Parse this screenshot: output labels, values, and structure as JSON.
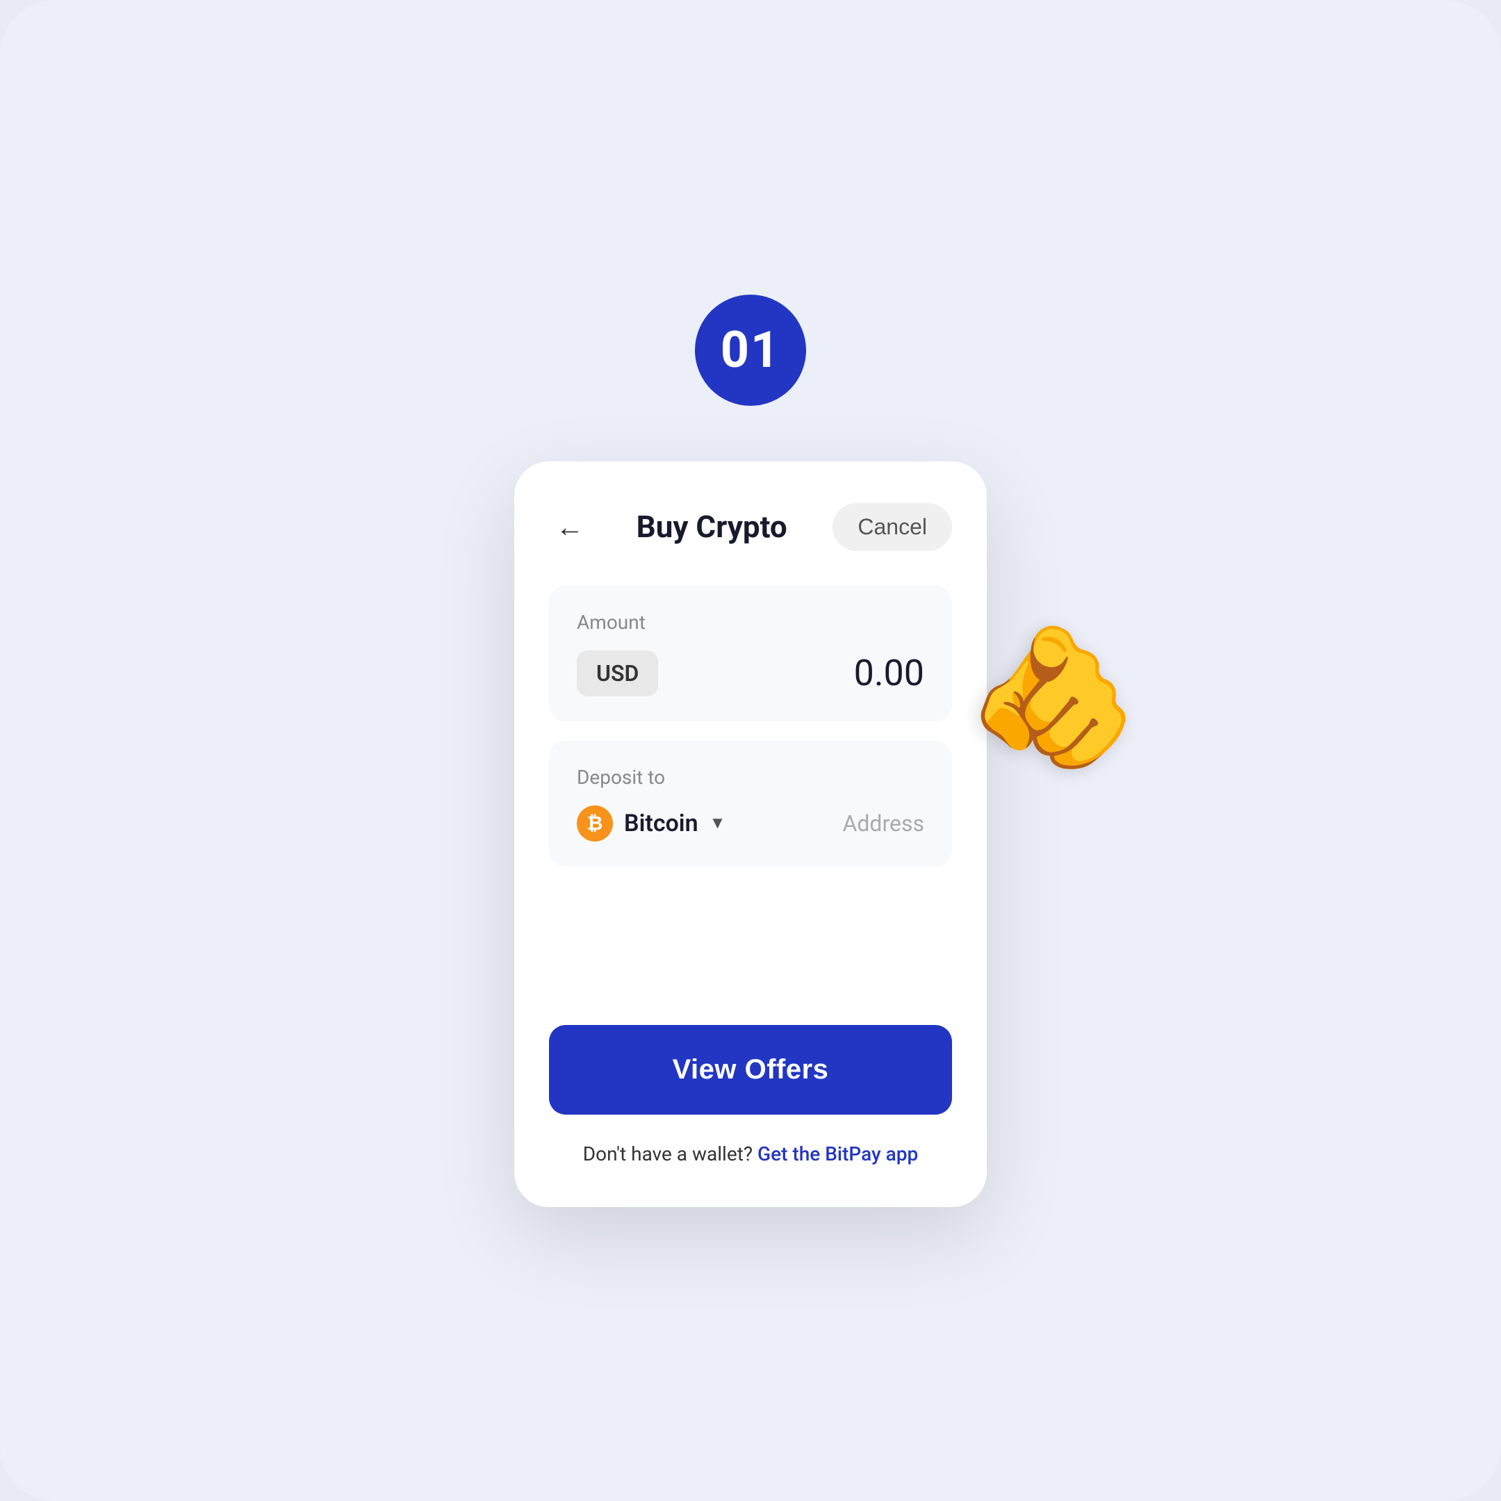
{
  "step": {
    "number": "01"
  },
  "header": {
    "title": "Buy Crypto",
    "cancel_label": "Cancel"
  },
  "amount_section": {
    "label": "Amount",
    "currency": "USD",
    "value": "0.00"
  },
  "deposit_section": {
    "label": "Deposit to",
    "coin": "Bitcoin",
    "address_placeholder": "Address"
  },
  "cta": {
    "view_offers": "View Offers"
  },
  "wallet_text": {
    "prefix": "Don't have a wallet?",
    "link": "Get the BitPay app"
  },
  "colors": {
    "accent": "#2236c3",
    "bitcoin_orange": "#f7931a",
    "background": "#eceef8"
  }
}
